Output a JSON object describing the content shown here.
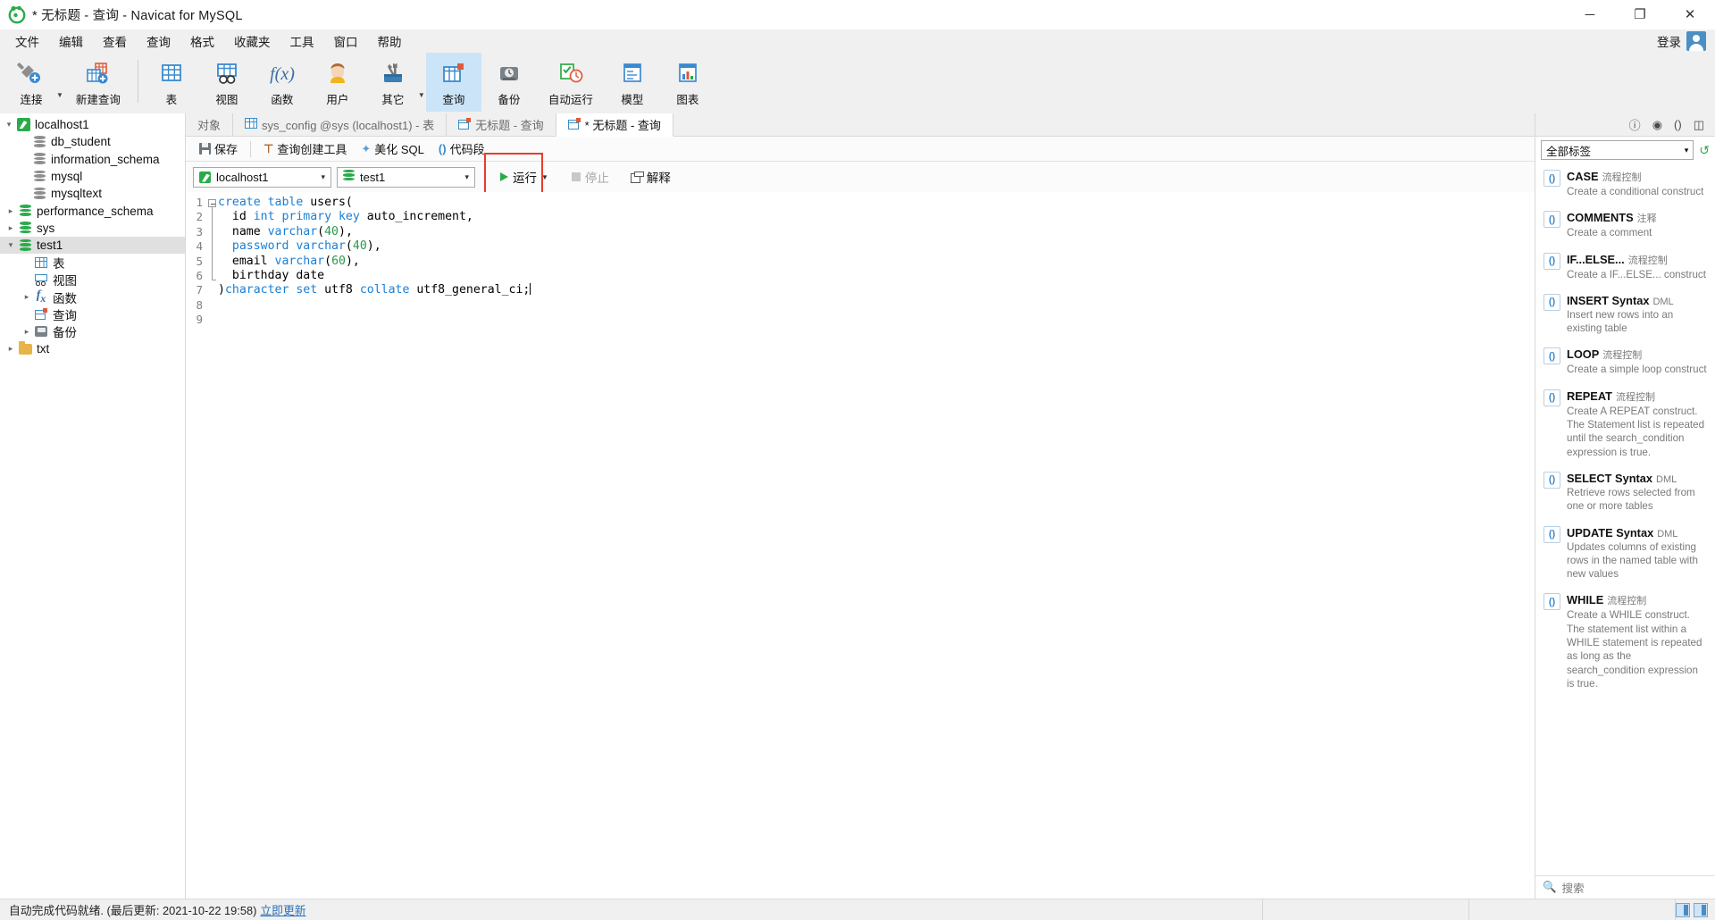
{
  "window": {
    "title": "* 无标题 - 查询 - Navicat for MySQL",
    "minimize": "─",
    "maximize": "❐",
    "close": "✕"
  },
  "menubar": {
    "items": [
      "文件",
      "编辑",
      "查看",
      "查询",
      "格式",
      "收藏夹",
      "工具",
      "窗口",
      "帮助"
    ],
    "login_label": "登录"
  },
  "toolbar": {
    "items": [
      {
        "label": "连接",
        "icon": "connection-icon",
        "has_caret": true
      },
      {
        "label": "新建查询",
        "icon": "new-query-icon",
        "has_caret": false
      },
      {
        "label": "表",
        "icon": "table-icon",
        "has_caret": false
      },
      {
        "label": "视图",
        "icon": "view-icon",
        "has_caret": false
      },
      {
        "label": "函数",
        "icon": "function-icon",
        "has_caret": false
      },
      {
        "label": "用户",
        "icon": "user-icon",
        "has_caret": false
      },
      {
        "label": "其它",
        "icon": "others-icon",
        "has_caret": true
      },
      {
        "label": "查询",
        "icon": "query-icon",
        "has_caret": false,
        "active": true
      },
      {
        "label": "备份",
        "icon": "backup-icon",
        "has_caret": false
      },
      {
        "label": "自动运行",
        "icon": "automation-icon",
        "has_caret": false
      },
      {
        "label": "模型",
        "icon": "model-icon",
        "has_caret": false
      },
      {
        "label": "图表",
        "icon": "chart-icon",
        "has_caret": false
      }
    ]
  },
  "sidebar": {
    "tree": [
      {
        "label": "localhost1",
        "icon": "connection-icon",
        "indent": 0,
        "twisty": "expanded"
      },
      {
        "label": "db_student",
        "icon": "database-gray-icon",
        "indent": 1,
        "twisty": "none"
      },
      {
        "label": "information_schema",
        "icon": "database-gray-icon",
        "indent": 1,
        "twisty": "none"
      },
      {
        "label": "mysql",
        "icon": "database-gray-icon",
        "indent": 1,
        "twisty": "none"
      },
      {
        "label": "mysqltext",
        "icon": "database-gray-icon",
        "indent": 1,
        "twisty": "none"
      },
      {
        "label": "performance_schema",
        "icon": "database-green-icon",
        "indent": 1,
        "twisty": "collapsed"
      },
      {
        "label": "sys",
        "icon": "database-green-icon",
        "indent": 1,
        "twisty": "collapsed"
      },
      {
        "label": "test1",
        "icon": "database-green-icon",
        "indent": 1,
        "twisty": "expanded",
        "selected": true
      },
      {
        "label": "表",
        "icon": "table-icon",
        "indent": 2,
        "twisty": "none"
      },
      {
        "label": "视图",
        "icon": "view-icon",
        "indent": 2,
        "twisty": "none"
      },
      {
        "label": "函数",
        "icon": "function-icon",
        "indent": 2,
        "twisty": "collapsed"
      },
      {
        "label": "查询",
        "icon": "query-icon",
        "indent": 2,
        "twisty": "none"
      },
      {
        "label": "备份",
        "icon": "backup-icon",
        "indent": 2,
        "twisty": "collapsed"
      },
      {
        "label": "txt",
        "icon": "folder-icon",
        "indent": 1,
        "twisty": "collapsed"
      }
    ]
  },
  "object_tabs": [
    {
      "label": "对象",
      "icon": "none",
      "active": false
    },
    {
      "label": "sys_config @sys (localhost1) - 表",
      "icon": "table-icon",
      "active": false
    },
    {
      "label": "无标题 - 查询",
      "icon": "query-icon",
      "active": false
    },
    {
      "label": "* 无标题 - 查询",
      "icon": "query-icon",
      "active": true
    }
  ],
  "query_toolbar": {
    "save": "保存",
    "query_builder": "查询创建工具",
    "beautify_sql": "美化 SQL",
    "code_snippet": "代码段"
  },
  "conn_bar": {
    "connection": "localhost1",
    "database": "test1",
    "run": "运行",
    "stop": "停止",
    "explain": "解释"
  },
  "editor": {
    "line_numbers": [
      "1",
      "2",
      "3",
      "4",
      "5",
      "6",
      "7",
      "8",
      "9"
    ],
    "lines": [
      [
        {
          "t": "create table ",
          "c": "kw"
        },
        {
          "t": "users(",
          "c": "pl"
        }
      ],
      [
        {
          "t": "  id ",
          "c": "pl"
        },
        {
          "t": "int primary key ",
          "c": "kw"
        },
        {
          "t": "auto_increment,",
          "c": "pl"
        }
      ],
      [
        {
          "t": "  name ",
          "c": "pl"
        },
        {
          "t": "varchar",
          "c": "kw"
        },
        {
          "t": "(",
          "c": "pl"
        },
        {
          "t": "40",
          "c": "num"
        },
        {
          "t": "),",
          "c": "pl"
        }
      ],
      [
        {
          "t": "  password ",
          "c": "kw"
        },
        {
          "t": "varchar",
          "c": "kw"
        },
        {
          "t": "(",
          "c": "pl"
        },
        {
          "t": "40",
          "c": "num"
        },
        {
          "t": "),",
          "c": "pl"
        }
      ],
      [
        {
          "t": "  email ",
          "c": "pl"
        },
        {
          "t": "varchar",
          "c": "kw"
        },
        {
          "t": "(",
          "c": "pl"
        },
        {
          "t": "60",
          "c": "num"
        },
        {
          "t": "),",
          "c": "pl"
        }
      ],
      [
        {
          "t": "  birthday date",
          "c": "pl"
        }
      ],
      [
        {
          "t": ")",
          "c": "pl"
        },
        {
          "t": "character set ",
          "c": "kw"
        },
        {
          "t": "utf8 ",
          "c": "pl"
        },
        {
          "t": "collate ",
          "c": "kw"
        },
        {
          "t": "utf8_general_ci;",
          "c": "pl"
        }
      ],
      [
        {
          "t": "",
          "c": "pl"
        }
      ],
      [
        {
          "t": "",
          "c": "pl"
        }
      ]
    ]
  },
  "right_panel": {
    "tab_icons": [
      "info-icon",
      "history-icon",
      "snippet-icon",
      "structure-icon"
    ],
    "filter_value": "全部标签",
    "refresh_icon": "refresh-icon",
    "search_placeholder": "搜索",
    "snippets": [
      {
        "name": "CASE",
        "category": "流程控制",
        "desc": "Create a conditional construct"
      },
      {
        "name": "COMMENTS",
        "category": "注释",
        "desc": "Create a comment"
      },
      {
        "name": "IF...ELSE...",
        "category": "流程控制",
        "desc": "Create a IF...ELSE... construct"
      },
      {
        "name": "INSERT Syntax",
        "category": "DML",
        "desc": "Insert new rows into an existing table"
      },
      {
        "name": "LOOP",
        "category": "流程控制",
        "desc": "Create a simple loop construct"
      },
      {
        "name": "REPEAT",
        "category": "流程控制",
        "desc": "Create A REPEAT construct. The Statement list is repeated until the search_condition expression is true."
      },
      {
        "name": "SELECT Syntax",
        "category": "DML",
        "desc": "Retrieve rows selected from one or more tables"
      },
      {
        "name": "UPDATE Syntax",
        "category": "DML",
        "desc": "Updates columns of existing rows in the named table with new values"
      },
      {
        "name": "WHILE",
        "category": "流程控制",
        "desc": "Create a WHILE construct. The statement list within a WHILE statement is repeated as long as the search_condition expression is true."
      }
    ]
  },
  "statusbar": {
    "message": "自动完成代码就绪. (最后更新: 2021-10-22 19:58)",
    "update_link": "立即更新"
  },
  "colors": {
    "accent_green": "#2aab4a",
    "accent_blue": "#3a8ad0",
    "highlight_red": "#e83c2c",
    "tab_active_bg": "#cce4f7"
  }
}
